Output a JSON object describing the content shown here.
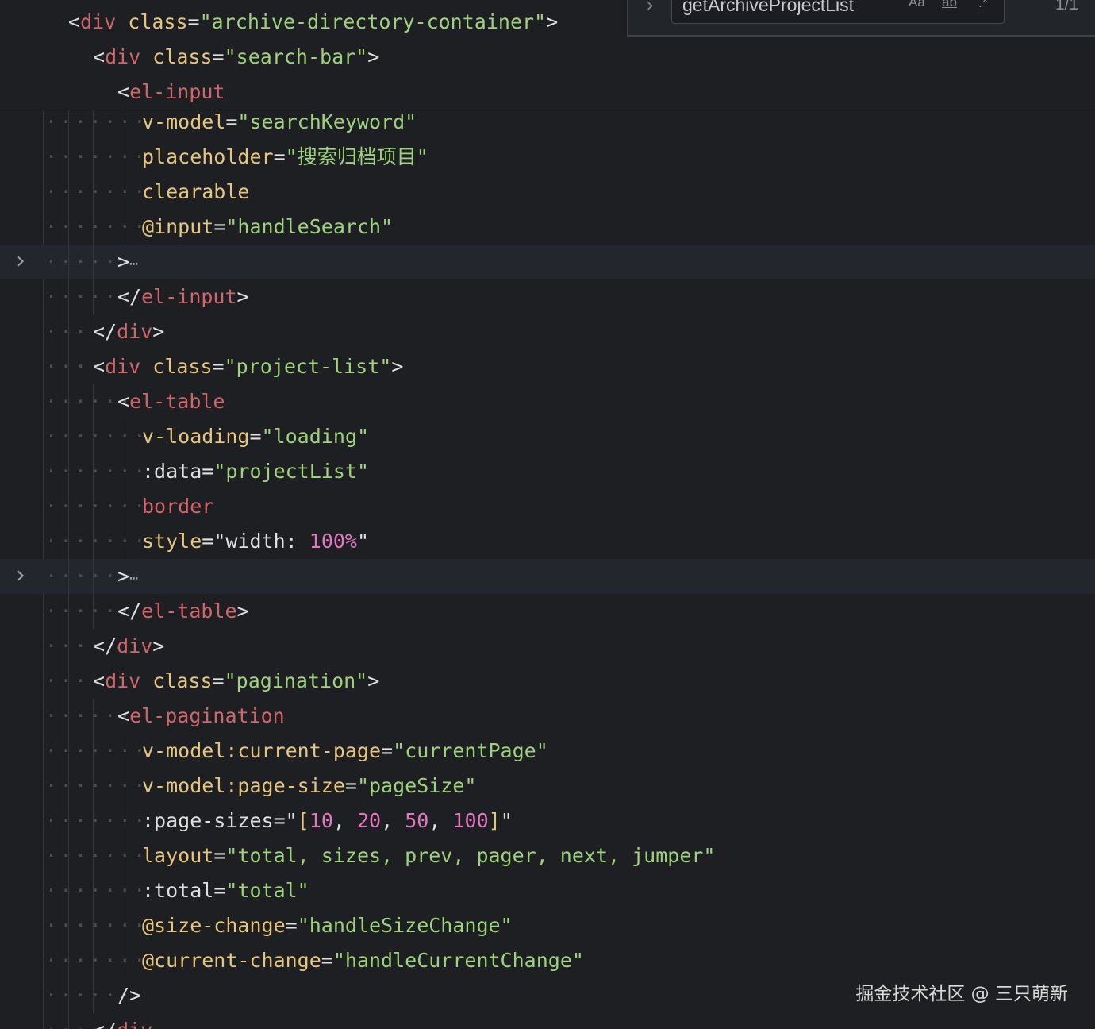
{
  "find_widget": {
    "query": "getArchiveProjectList",
    "match_case_label": "Aa",
    "whole_word_label": "ab",
    "regex_label": ".*",
    "result_count": "1/1",
    "toggle_icon": "chevron-right-icon"
  },
  "sticky_lines": [
    {
      "tag_open": "<",
      "tag": "div",
      "attr": "class",
      "eq": "=",
      "value": "\"archive-directory-container\"",
      "close": ">"
    },
    {
      "tag_open": "<",
      "tag": "div",
      "attr": "class",
      "eq": "=",
      "value": "\"search-bar\"",
      "close": ">"
    },
    {
      "tag_open": "<",
      "tag": "el-input"
    }
  ],
  "lines": {
    "l1": {
      "attr": "v-model",
      "eq": "=",
      "value": "\"searchKeyword\""
    },
    "l2": {
      "attr": "placeholder",
      "eq": "=",
      "value": "\"搜索归档项目\""
    },
    "l3": {
      "attr": "clearable"
    },
    "l4": {
      "attr": "@input",
      "eq": "=",
      "value": "\"handleSearch\""
    },
    "l5": {
      "close": ">",
      "ellipsis": "⋯"
    },
    "l6": {
      "open": "</",
      "tag": "el-input",
      "close": ">"
    },
    "l7": {
      "open": "</",
      "tag": "div",
      "close": ">"
    },
    "l8": {
      "open": "<",
      "tag": "div",
      "attr": "class",
      "eq": "=",
      "value": "\"project-list\"",
      "close": ">"
    },
    "l9": {
      "open": "<",
      "tag": "el-table"
    },
    "l10": {
      "attr": "v-loading",
      "eq": "=",
      "value": "\"loading\""
    },
    "l11": {
      "attr": ":data",
      "eq": "=",
      "value": "\"projectList\""
    },
    "l12": {
      "attr": "border"
    },
    "l13": {
      "attr": "style",
      "eq": "=",
      "q1": "\"",
      "text": "width:",
      "num": "100%",
      "q2": "\""
    },
    "l14": {
      "close": ">",
      "ellipsis": "⋯"
    },
    "l15": {
      "open": "</",
      "tag": "el-table",
      "close": ">"
    },
    "l16": {
      "open": "</",
      "tag": "div",
      "close": ">"
    },
    "l17": {
      "open": "<",
      "tag": "div",
      "attr": "class",
      "eq": "=",
      "value": "\"pagination\"",
      "close": ">"
    },
    "l18": {
      "open": "<",
      "tag": "el-pagination"
    },
    "l19": {
      "attr": "v-model:current-page",
      "eq": "=",
      "value": "\"currentPage\""
    },
    "l20": {
      "attr": "v-model:page-size",
      "eq": "=",
      "value": "\"pageSize\""
    },
    "l21": {
      "attr": ":page-sizes",
      "eq": "=",
      "q1": "\"",
      "b1": "[",
      "n1": "10",
      "c1": ",",
      "n2": "20",
      "c2": ",",
      "n3": "50",
      "c3": ",",
      "n4": "100",
      "b2": "]",
      "q2": "\""
    },
    "l22": {
      "attr": "layout",
      "eq": "=",
      "value": "\"total, sizes, prev, pager, next, jumper\""
    },
    "l23": {
      "attr": ":total",
      "eq": "=",
      "value": "\"total\""
    },
    "l24": {
      "attr": "@size-change",
      "eq": "=",
      "value": "\"handleSizeChange\""
    },
    "l25": {
      "attr": "@current-change",
      "eq": "=",
      "value": "\"handleCurrentChange\""
    },
    "l26": {
      "close": "/>"
    },
    "l27": {
      "open": "</",
      "tag": "div"
    }
  },
  "watermark": "掘金技术社区 @ 三只萌新",
  "colors": {
    "background": "#1d1f22",
    "tag": "#d0656a",
    "attribute": "#e5c67c",
    "string": "#9fd27c",
    "number": "#e377c2",
    "fold_highlight": "#23262c"
  },
  "icons": {
    "fold": "chevron-right-icon"
  }
}
